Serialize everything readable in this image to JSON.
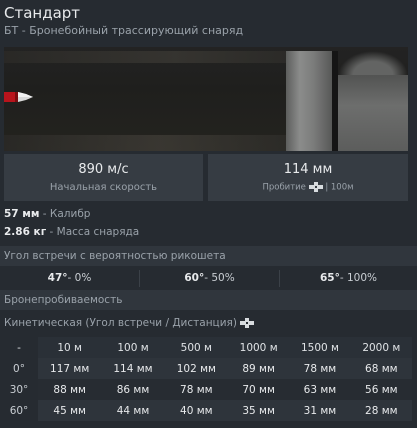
{
  "header": {
    "title": "Стандарт",
    "subtitle": "БТ - Бронебойный трассирующий снаряд"
  },
  "stats": {
    "velocity_value": "890 м/с",
    "velocity_label": "Начальная скорость",
    "penetration_value": "114 мм",
    "penetration_label": "Пробитие",
    "penetration_distance": "| 100м"
  },
  "params": {
    "caliber_value": "57 мм",
    "caliber_label": "- Калибр",
    "mass_value": "2.86 кг",
    "mass_label": "- Масса снаряда"
  },
  "ricochet": {
    "header": "Угол встречи с вероятностью рикошета",
    "cells": [
      {
        "angle": "47°",
        "chance": "- 0%"
      },
      {
        "angle": "60°",
        "chance": "- 50%"
      },
      {
        "angle": "65°",
        "chance": "- 100%"
      }
    ]
  },
  "penetration": {
    "header": "Бронепробиваемость",
    "kinetic_label": "Кинетическая (Угол встречи / Дистанция)",
    "corner": "-",
    "distances": [
      "10 м",
      "100 м",
      "500 м",
      "1000 м",
      "1500 м",
      "2000 м"
    ],
    "rows": [
      {
        "angle": "0°",
        "values": [
          "117 мм",
          "114 мм",
          "102 мм",
          "89 мм",
          "78 мм",
          "68 мм"
        ]
      },
      {
        "angle": "30°",
        "values": [
          "88 мм",
          "86 мм",
          "78 мм",
          "70 мм",
          "63 мм",
          "56 мм"
        ]
      },
      {
        "angle": "60°",
        "values": [
          "45 мм",
          "44 мм",
          "40 мм",
          "35 мм",
          "31 мм",
          "28 мм"
        ]
      }
    ]
  },
  "icons": {
    "projectile": "shell-icon",
    "penetration": "crosshair-icon"
  }
}
